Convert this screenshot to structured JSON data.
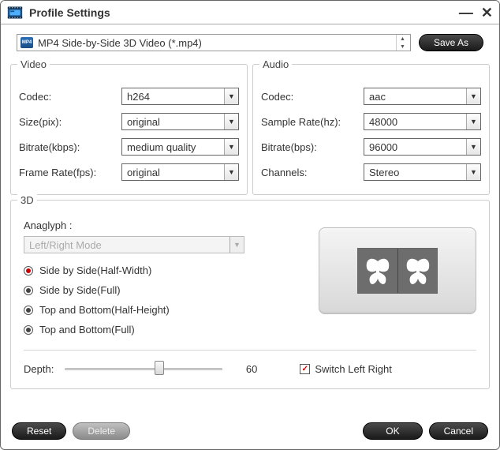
{
  "window": {
    "title": "Profile Settings"
  },
  "profile": {
    "selected": "MP4 Side-by-Side 3D Video (*.mp4)",
    "save_as_label": "Save As"
  },
  "video": {
    "legend": "Video",
    "codec_label": "Codec:",
    "codec_value": "h264",
    "size_label": "Size(pix):",
    "size_value": "original",
    "bitrate_label": "Bitrate(kbps):",
    "bitrate_value": "medium quality",
    "framerate_label": "Frame Rate(fps):",
    "framerate_value": "original"
  },
  "audio": {
    "legend": "Audio",
    "codec_label": "Codec:",
    "codec_value": "aac",
    "samplerate_label": "Sample Rate(hz):",
    "samplerate_value": "48000",
    "bitrate_label": "Bitrate(bps):",
    "bitrate_value": "96000",
    "channels_label": "Channels:",
    "channels_value": "Stereo"
  },
  "three_d": {
    "legend": "3D",
    "anaglyph_label": "Anaglyph :",
    "anaglyph_value": "Left/Right Mode",
    "radios": [
      "Side by Side(Half-Width)",
      "Side by Side(Full)",
      "Top and Bottom(Half-Height)",
      "Top and Bottom(Full)"
    ],
    "selected_radio_index": 0,
    "depth_label": "Depth:",
    "depth_value": "60",
    "depth_min": 0,
    "depth_max": 100,
    "switch_label": "Switch Left Right",
    "switch_checked": true
  },
  "footer": {
    "reset": "Reset",
    "delete": "Delete",
    "ok": "OK",
    "cancel": "Cancel"
  }
}
